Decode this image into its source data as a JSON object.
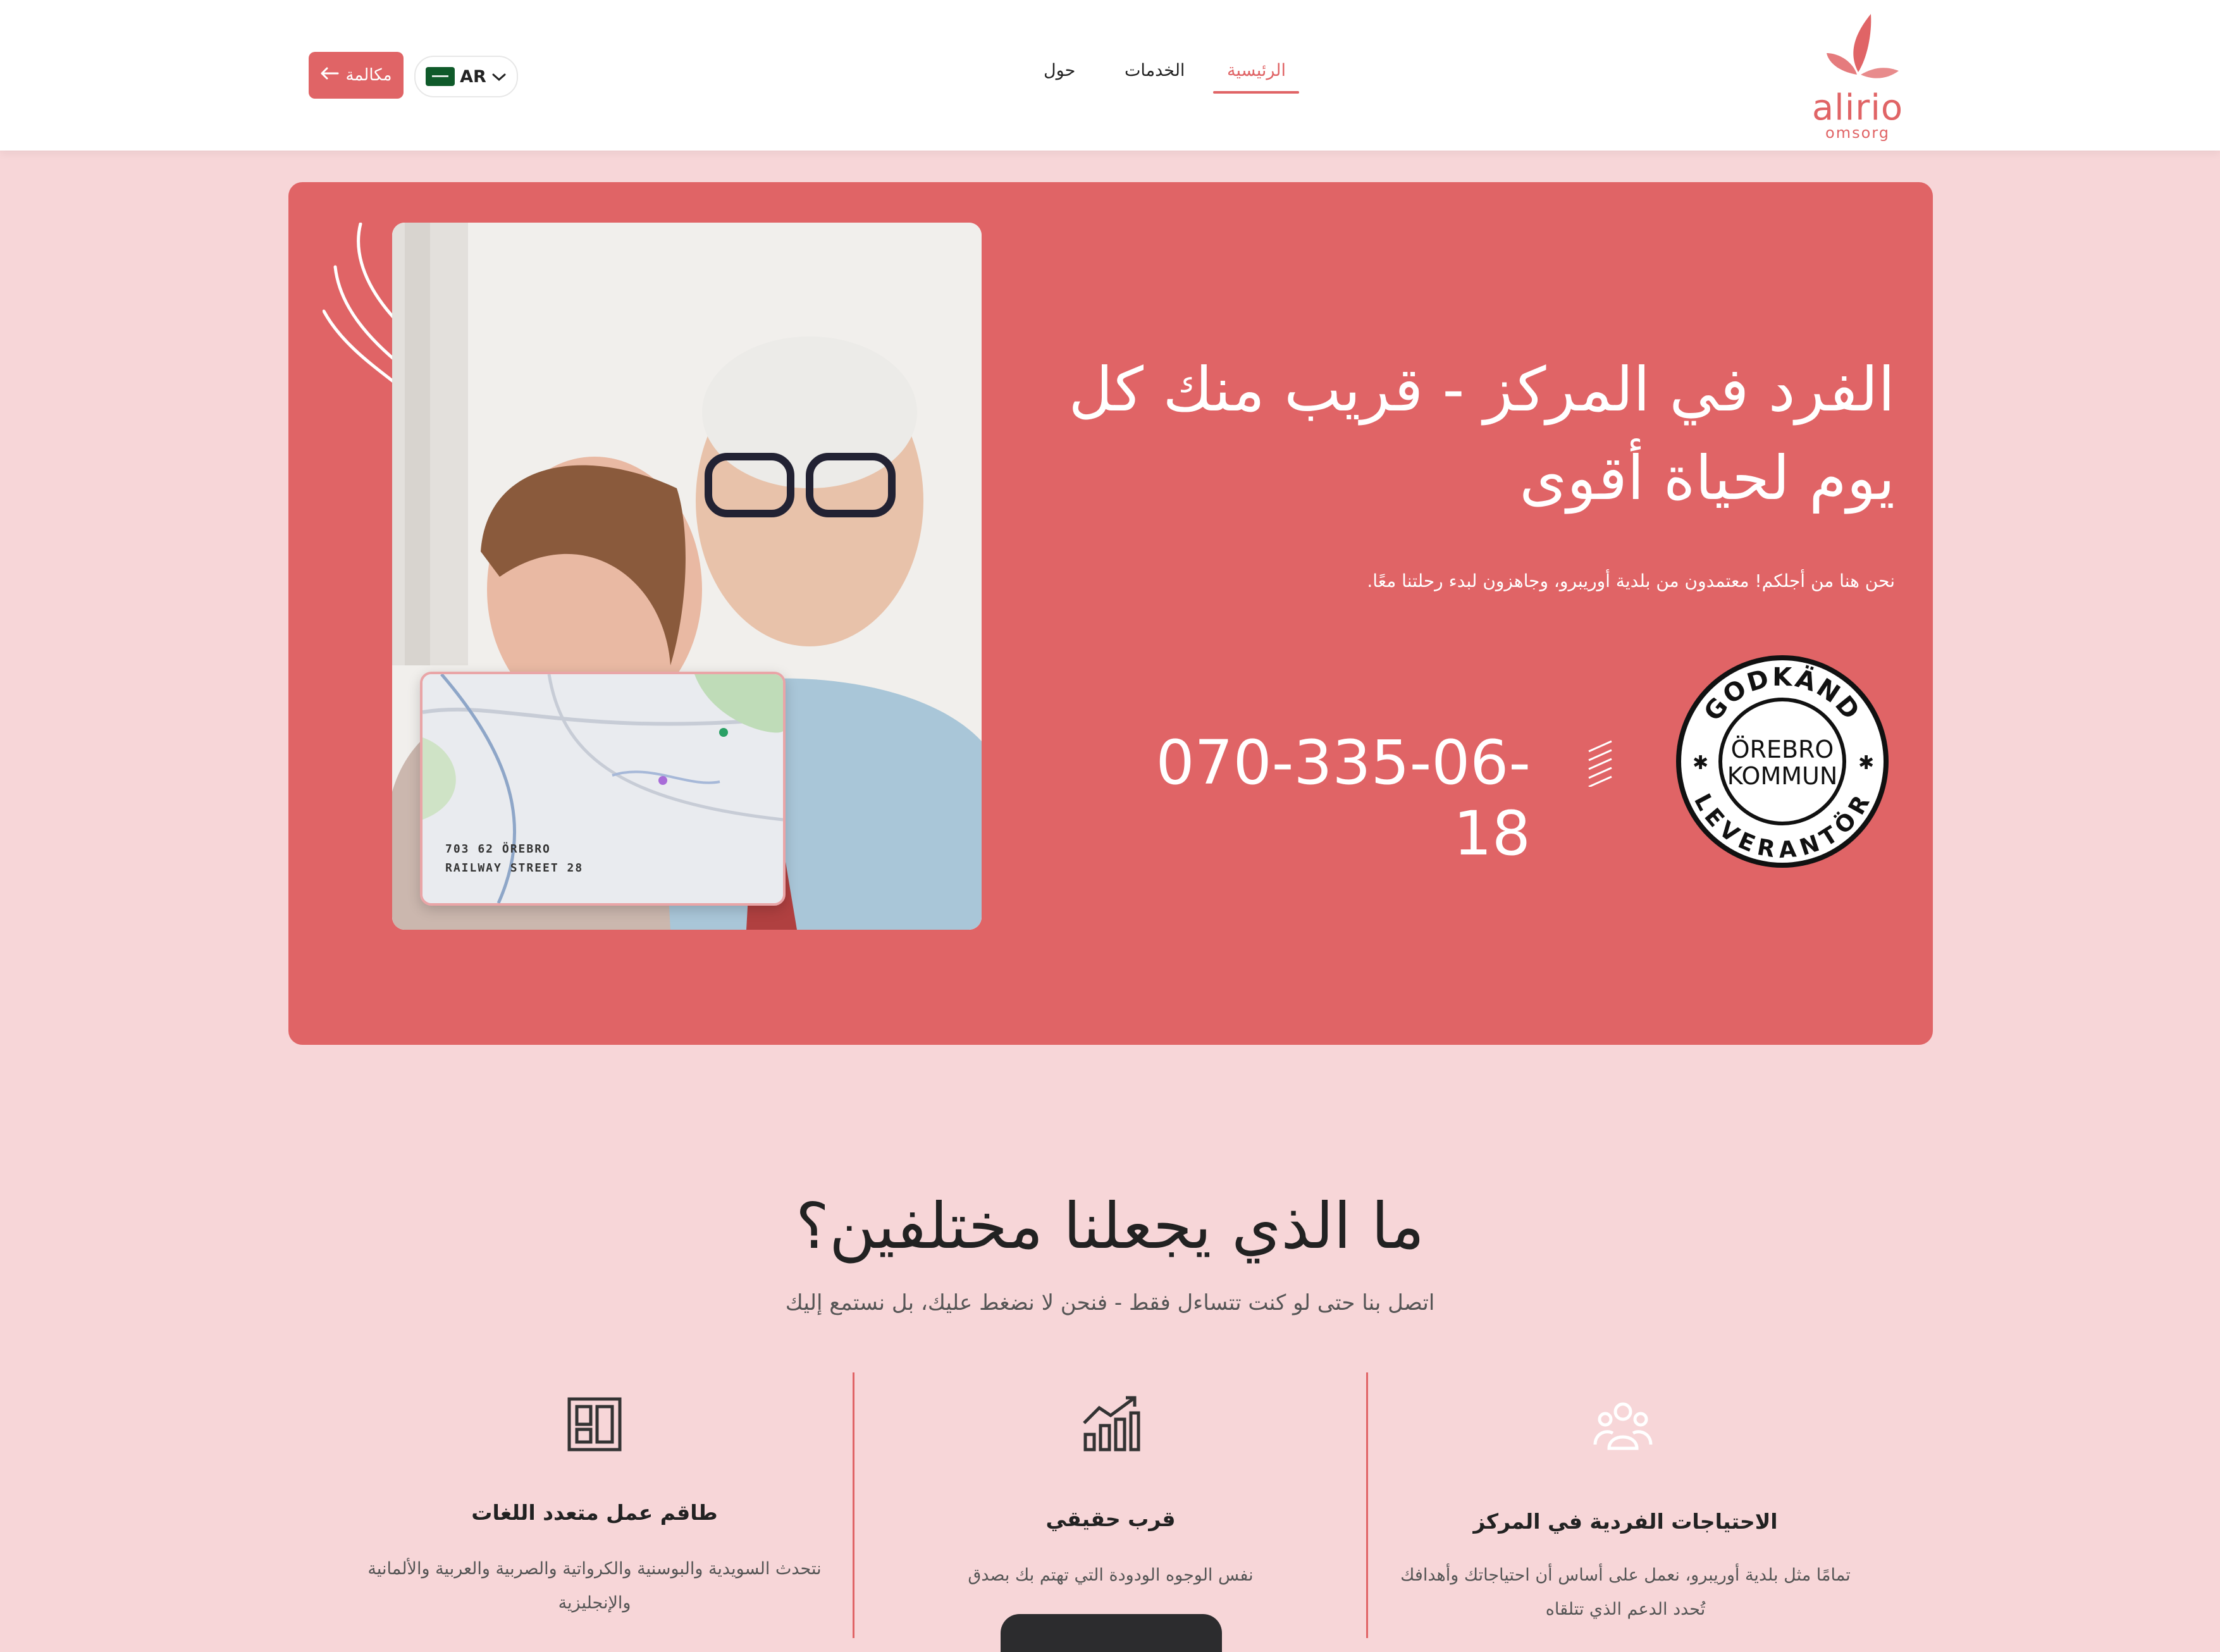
{
  "header": {
    "call_label": "مكالمة",
    "language": "AR",
    "nav": [
      "الرئيسية",
      "الخدمات",
      "حول"
    ],
    "active_nav": "الرئيسية",
    "logo_text": "alirio",
    "logo_sub": "omsorg"
  },
  "hero": {
    "title": "الفرد في المركز - قريب منك كل يوم لحياة أقوى",
    "subtitle": ".نحن هنا من أجلكم! معتمدون من بلدية أوريبرو، وجاهزون لبدء رحلتنا معًا",
    "phone": "070-335-06-18",
    "map_address_line1": "703 62 ÖREBRO",
    "map_address_line2": "RAILWAY STREET 28",
    "badge": {
      "top": "GODKÄND",
      "middle1": "ÖREBRO",
      "middle2": "KOMMUN",
      "bottom": "LEVERANTÖR"
    }
  },
  "section": {
    "title": "ما الذي يجعلنا مختلفين؟",
    "subtitle": "اتصل بنا حتى لو كنت تتساءل فقط - فنحن لا نضغط عليك، بل نستمع إليك",
    "features": [
      {
        "icon": "dashboard-icon",
        "title": "طاقم عمل متعدد اللغات",
        "desc": "نتحدث السويدية والبوسنية والكرواتية والصربية والعربية والألمانية والإنجليزية"
      },
      {
        "icon": "growth-chart-icon",
        "title": "قرب حقيقي",
        "desc": "نفس الوجوه الودودة التي تهتم بك بصدق"
      },
      {
        "icon": "people-group-icon",
        "title": "الاحتياجات الفردية في المركز",
        "desc": "تمامًا مثل بلدية أوريبرو، نعمل على أساس أن احتياجاتك وأهدافك تُحدد الدعم الذي تتلقاه"
      }
    ]
  },
  "colors": {
    "accent": "#e06466",
    "page_background": "#f7d6d8",
    "header_background": "#ffffff"
  }
}
